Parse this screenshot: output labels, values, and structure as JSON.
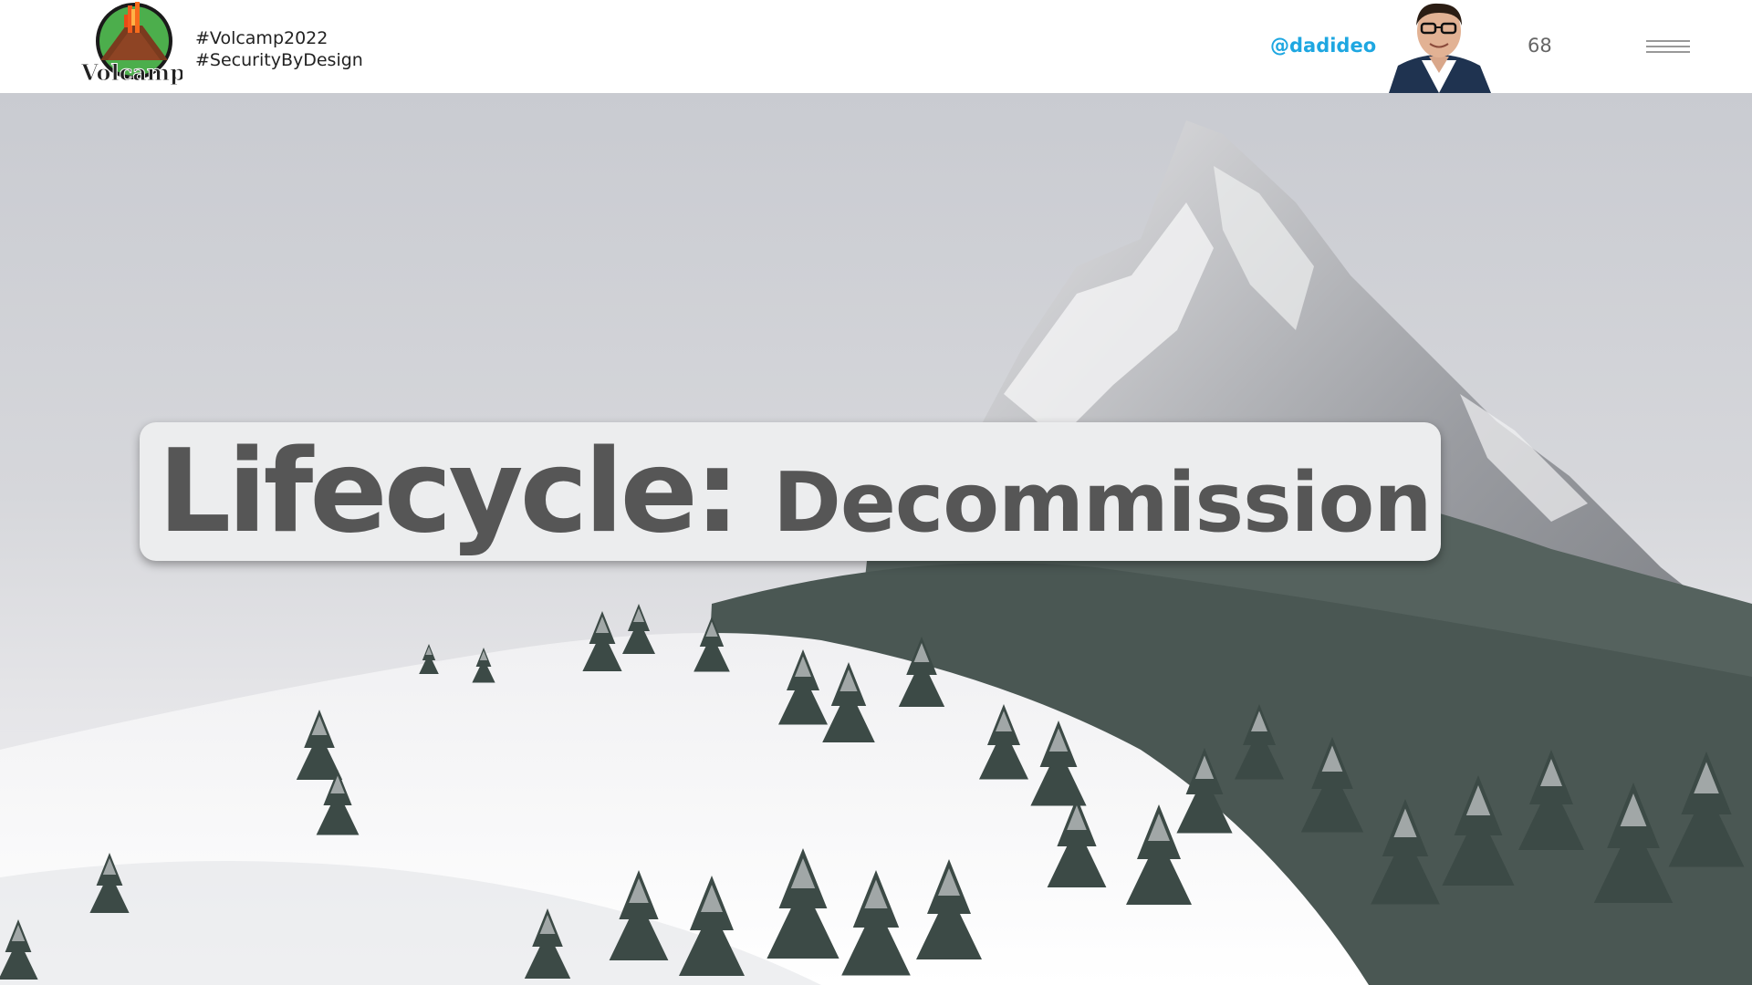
{
  "header": {
    "logo_text": "Volcamp",
    "hashtags": [
      "#Volcamp2022",
      "#SecurityByDesign"
    ],
    "handle": "@dadideo",
    "page_number": "68",
    "menu_icon": "hamburger-menu-icon"
  },
  "slide": {
    "title_main": "Lifecycle:",
    "title_sub": "Decommission"
  },
  "colors": {
    "handle": "#1ea7e1",
    "title_text": "#565656",
    "title_bg": "#ecedee"
  }
}
